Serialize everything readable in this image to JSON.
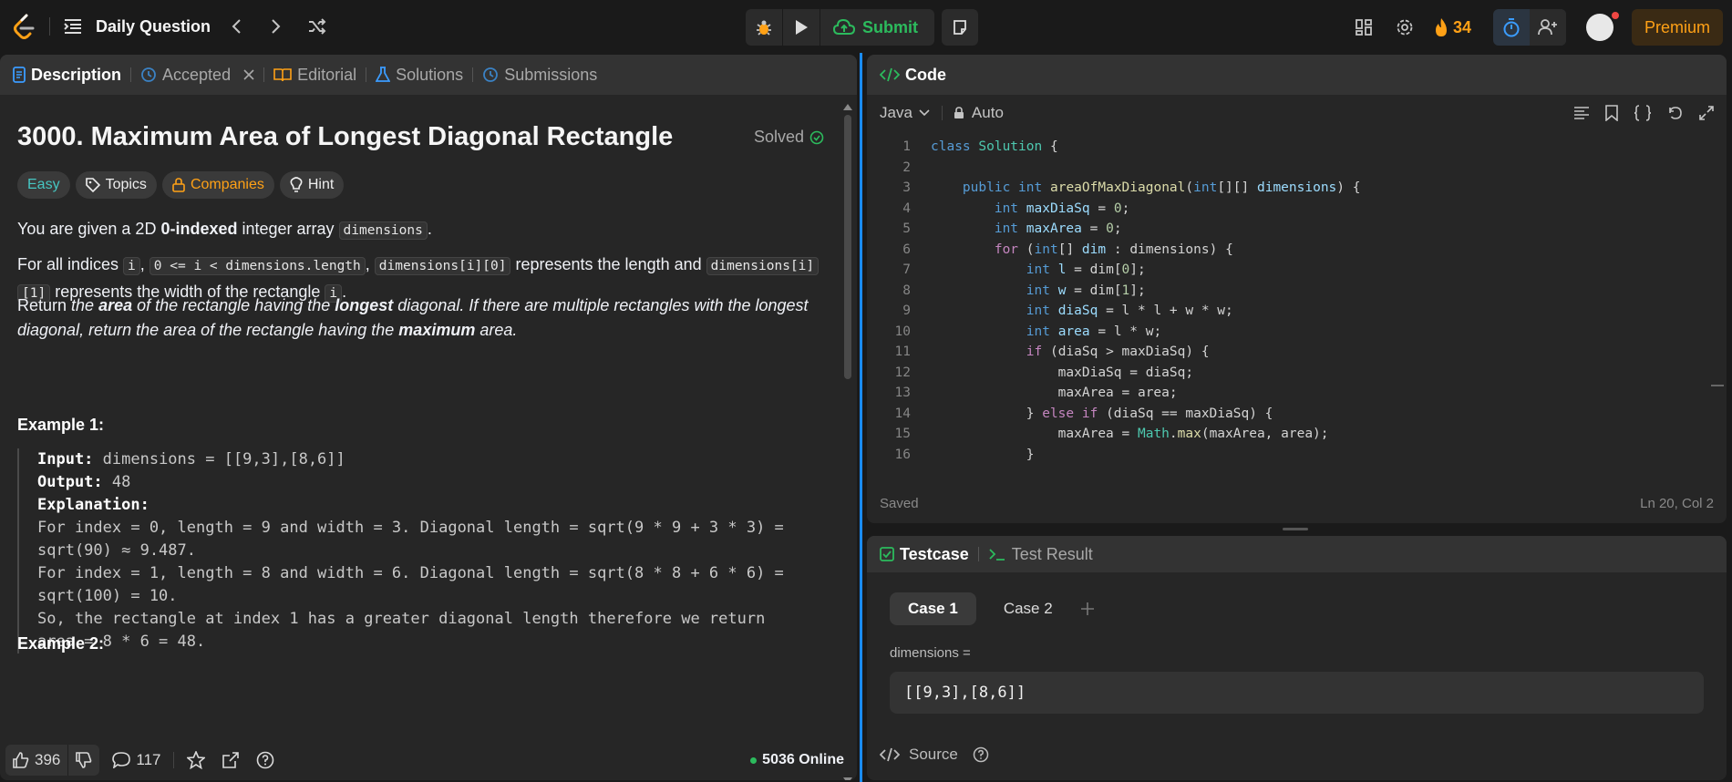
{
  "topbar": {
    "title": "Daily Question",
    "submit_label": "Submit",
    "streak_count": "34",
    "premium_label": "Premium"
  },
  "left_tabs": {
    "description": "Description",
    "accepted": "Accepted",
    "editorial": "Editorial",
    "solutions": "Solutions",
    "submissions": "Submissions"
  },
  "problem": {
    "title": "3000. Maximum Area of Longest Diagonal Rectangle",
    "solved_label": "Solved",
    "chips": {
      "difficulty": "Easy",
      "topics": "Topics",
      "companies": "Companies",
      "hint": "Hint"
    },
    "p1": {
      "a": "You are given a 2D ",
      "b": "0-indexed",
      "c": " integer array ",
      "code": "dimensions",
      "d": "."
    },
    "p2": {
      "a": "For all indices ",
      "c1": "i",
      "s1": ", ",
      "c2": "0 <= i < dimensions.length",
      "s2": ", ",
      "c3": "dimensions[i][0]",
      "b": " represents the length and ",
      "c4a": "dimensions[i]",
      "c4b": "[1]",
      "d": " represents the width of the rectangle ",
      "c5": "i",
      "e": "."
    },
    "p3": {
      "a": "Return ",
      "b": "the ",
      "c": "area",
      "d": " of the rectangle having the ",
      "e": "longest",
      "f": " diagonal. If there are multiple rectangles with the longest diagonal, return the area of the rectangle having the ",
      "g": "maximum",
      "h": " area."
    },
    "example1_heading": "Example 1:",
    "example1": {
      "input_label": "Input:",
      "input_value": " dimensions = [[9,3],[8,6]]",
      "output_label": "Output:",
      "output_value": " 48",
      "explanation_label": "Explanation:",
      "lines": [
        "For index = 0, length = 9 and width = 3. Diagonal length = sqrt(9 * 9 + 3 * 3) =",
        "sqrt(90) ≈ 9.487.",
        "For index = 1, length = 8 and width = 6. Diagonal length = sqrt(8 * 8 + 6 * 6) =",
        "sqrt(100) = 10.",
        "So, the rectangle at index 1 has a greater diagonal length therefore we return",
        "area = 8 * 6 = 48."
      ]
    },
    "example2_heading": "Example 2:"
  },
  "footer": {
    "likes": "396",
    "comments": "117",
    "online": "5036 Online"
  },
  "code_panel": {
    "title": "Code",
    "language": "Java",
    "mode": "Auto",
    "saved_label": "Saved",
    "cursor": "Ln 20, Col 2"
  },
  "test_panel": {
    "tab_testcase": "Testcase",
    "tab_result": "Test Result",
    "cases": [
      "Case 1",
      "Case 2"
    ],
    "param_label": "dimensions =",
    "param_value": "[[9,3],[8,6]]",
    "source_label": "Source"
  }
}
